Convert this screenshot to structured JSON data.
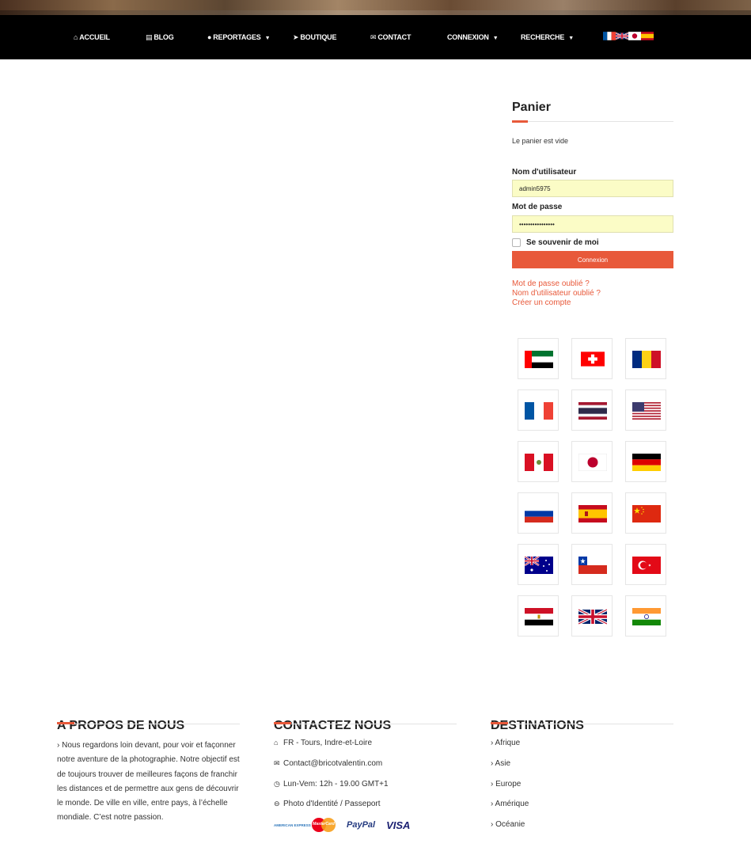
{
  "nav": {
    "items": [
      {
        "icon": "home-icon",
        "glyph": "⌂",
        "label": "ACCUEIL",
        "dropdown": false
      },
      {
        "icon": "newspaper-icon",
        "glyph": "▤",
        "label": "BLOG",
        "dropdown": false
      },
      {
        "icon": "globe-icon",
        "glyph": "●",
        "label": "REPORTAGES",
        "dropdown": true
      },
      {
        "icon": "rocket-icon",
        "glyph": "➤",
        "label": "BOUTIQUE",
        "dropdown": false
      },
      {
        "icon": "envelope-icon",
        "glyph": "✉",
        "label": "CONTACT",
        "dropdown": false
      },
      {
        "icon": "",
        "glyph": "",
        "label": "CONNEXION",
        "dropdown": true
      },
      {
        "icon": "",
        "glyph": "",
        "label": "RECHERCHE",
        "dropdown": true
      }
    ],
    "language_flags": [
      "fr",
      "gb",
      "jp",
      "es"
    ]
  },
  "sidebar": {
    "cart_title": "Panier",
    "cart_empty": "Le panier est vide",
    "username_label": "Nom d'utilisateur",
    "username_value": "admin5975",
    "password_label": "Mot de passe",
    "password_value": "••••••••••••••••",
    "remember_label": "Se souvenir de moi",
    "login_button": "Connexion",
    "forgot_password": "Mot de passe oublié ?",
    "forgot_username": "Nom d'utilisateur oublié ?",
    "create_account": "Créer un compte"
  },
  "flags": [
    "ae",
    "ch",
    "ro",
    "fr",
    "th",
    "us",
    "pe",
    "jp",
    "de",
    "ru",
    "es",
    "cn",
    "au",
    "cl",
    "tr",
    "eg",
    "gb",
    "in"
  ],
  "footer": {
    "about": {
      "title": "A PROPOS DE NOUS",
      "text": "› Nous regardons loin devant, pour voir et façonner notre aventure de la photographie. Notre objectif est de toujours trouver de meilleures façons de franchir les distances et de permettre aux gens de découvrir le monde. De ville en ville, entre pays, à l’échelle mondiale. C’est notre passion."
    },
    "contact": {
      "title": "CONTACTEZ NOUS",
      "lines": [
        {
          "icon": "home-icon",
          "glyph": "⌂",
          "text": "FR - Tours, Indre-et-Loire"
        },
        {
          "icon": "envelope-icon",
          "glyph": "✉",
          "text": "Contact@bricotvalentin.com"
        },
        {
          "icon": "clock-icon",
          "glyph": "◷",
          "text": "Lun-Vem: 12h - 19.00 GMT+1"
        },
        {
          "icon": "minus-circle-icon",
          "glyph": "⊖",
          "text": "Photo d'Identité / Passeport"
        }
      ],
      "payments": [
        "AMERICAN EXPRESS",
        "MasterCard",
        "PayPal",
        "VISA"
      ]
    },
    "destinations": {
      "title": "DESTINATIONS",
      "items": [
        "› Afrique",
        "› Asie",
        "› Europe",
        "› Amérique",
        "› Océanie"
      ]
    }
  },
  "colors": {
    "accent": "#e8593a",
    "nav_bg": "#000000",
    "input_bg": "#fbfcc6"
  }
}
